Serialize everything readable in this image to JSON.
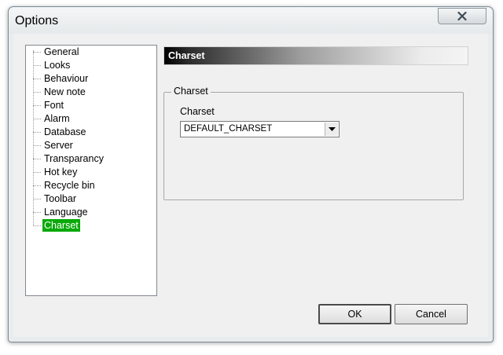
{
  "window": {
    "title": "Options"
  },
  "tree": {
    "items": [
      {
        "label": "General",
        "selected": false
      },
      {
        "label": "Looks",
        "selected": false
      },
      {
        "label": "Behaviour",
        "selected": false
      },
      {
        "label": "New note",
        "selected": false
      },
      {
        "label": "Font",
        "selected": false
      },
      {
        "label": "Alarm",
        "selected": false
      },
      {
        "label": "Database",
        "selected": false
      },
      {
        "label": "Server",
        "selected": false
      },
      {
        "label": "Transparancy",
        "selected": false
      },
      {
        "label": "Hot key",
        "selected": false
      },
      {
        "label": "Recycle bin",
        "selected": false
      },
      {
        "label": "Toolbar",
        "selected": false
      },
      {
        "label": "Language",
        "selected": false
      },
      {
        "label": "Charset",
        "selected": true
      }
    ],
    "selection_color": "#08a908"
  },
  "panel": {
    "header": "Charset",
    "group_title": "Charset",
    "field_label": "Charset",
    "charset_value": "DEFAULT_CHARSET"
  },
  "buttons": {
    "ok": "OK",
    "cancel": "Cancel"
  },
  "icons": {
    "close": "close-icon",
    "dropdown": "chevron-down-icon"
  }
}
